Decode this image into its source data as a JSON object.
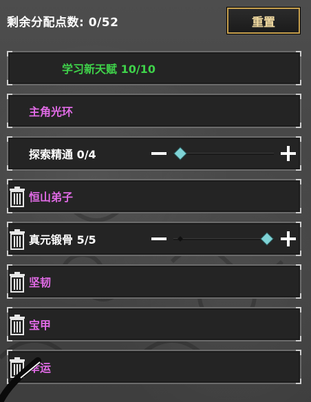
{
  "header": {
    "remaining_label": "剩余分配点数: 0/52",
    "reset_label": "重置"
  },
  "colors": {
    "green": "#3fd24a",
    "purple": "#e16be6",
    "accent_gold": "#c9a24f",
    "knob": "#7fd3d6"
  },
  "rows": [
    {
      "label": "学习新天赋 10/10",
      "color": "green",
      "trash": false
    },
    {
      "label": "主角光环",
      "color": "purple",
      "trash": false
    },
    {
      "label": "探索精通 0/4",
      "color": "white",
      "trash": false,
      "stepper": {
        "value": 0,
        "max": 4
      }
    },
    {
      "label": "恒山弟子",
      "color": "purple",
      "trash": true
    },
    {
      "label": "真元锻骨 5/5",
      "color": "white",
      "trash": true,
      "stepper": {
        "value": 5,
        "max": 5
      }
    },
    {
      "label": "坚韧",
      "color": "purple",
      "trash": true
    },
    {
      "label": "宝甲",
      "color": "purple",
      "trash": true
    },
    {
      "label": "幸运",
      "color": "purple",
      "trash": true
    }
  ]
}
